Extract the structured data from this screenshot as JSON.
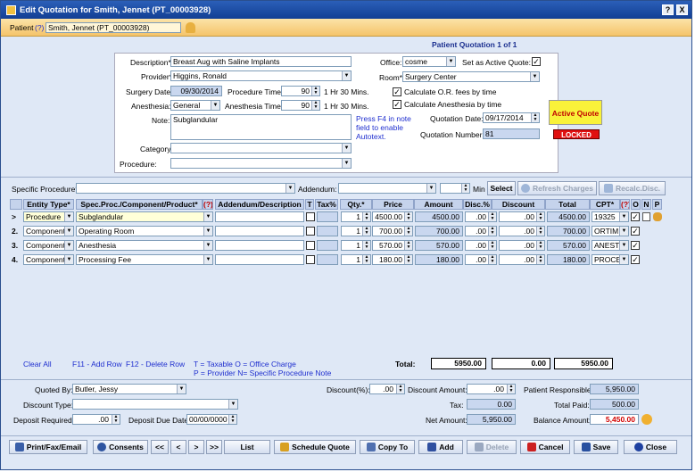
{
  "window": {
    "title": "Edit Quotation for Smith, Jennet  (PT_00003928)",
    "help": "?",
    "close": "X"
  },
  "patient": {
    "label": "Patient",
    "help": "(?)",
    "value": "Smith, Jennet  (PT_00003928)"
  },
  "header": {
    "quotation_title": "Patient Quotation 1 of 1",
    "description_label": "Description*",
    "description": "Breast Aug with Saline Implants",
    "provider_label": "Provider*",
    "provider": "Higgins, Ronald",
    "surgery_date_label": "Surgery Date:",
    "surgery_date": "09/30/2014",
    "procedure_time_label": "Procedure Time*",
    "procedure_time": "90",
    "procedure_time_text": "1 Hr 30 Mins.",
    "anesthesia_label": "Anesthesia:",
    "anesthesia": "General",
    "anesthesia_time_label": "Anesthesia Time:",
    "anesthesia_time": "90",
    "anesthesia_time_text": "1 Hr 30 Mins.",
    "note_label": "Note:",
    "note": "Subglandular",
    "note_hint": "Press F4 in note field to enable Autotext.",
    "category_label": "Category:",
    "category": "",
    "procedure_label": "Procedure:",
    "procedure": "",
    "office_label": "Office:",
    "office": "cosme",
    "active_quote_label": "Set as Active Quote:",
    "room_label": "Room*",
    "room": "Surgery Center",
    "calc_or_label": "Calculate O.R. fees by time",
    "calc_anesthesia_label": "Calculate Anesthesia by time",
    "quotation_date_label": "Quotation Date:",
    "quotation_date": "09/17/2014",
    "quotation_number_label": "Quotation Number:",
    "quotation_number": "81",
    "active_badge": "Active Quote",
    "locked_badge": "LOCKED"
  },
  "spec": {
    "specific_procedure_label": "Specific Procedure*",
    "addendum_label": "Addendum:",
    "min_label": "Min",
    "select_btn": "Select",
    "refresh_btn": "Refresh Charges",
    "recalc_btn": "Recalc.Disc."
  },
  "grid": {
    "columns": [
      "Entity Type*",
      "Spec.Proc./Component/Product*",
      "(?)",
      "Addendum/Description",
      "T",
      "Tax%",
      "Qty.*",
      "Price",
      "Amount",
      "Disc.%",
      "Discount",
      "Total",
      "CPT*",
      "(?)",
      "O",
      "N",
      "P"
    ],
    "rows": [
      {
        "marker": ">",
        "entity": "Procedure",
        "spec": "Subglandular",
        "qty": "1",
        "price": "4500.00",
        "amount": "4500.00",
        "disc_pct": ".00",
        "discount": ".00",
        "total": "4500.00",
        "cpt": "19325"
      },
      {
        "marker": "2.",
        "entity": "Component",
        "spec": "Operating Room",
        "qty": "1",
        "price": "700.00",
        "amount": "700.00",
        "disc_pct": ".00",
        "discount": ".00",
        "total": "700.00",
        "cpt": "ORTIM"
      },
      {
        "marker": "3.",
        "entity": "Component",
        "spec": "Anesthesia",
        "qty": "1",
        "price": "570.00",
        "amount": "570.00",
        "disc_pct": ".00",
        "discount": ".00",
        "total": "570.00",
        "cpt": "ANEST"
      },
      {
        "marker": "4.",
        "entity": "Component",
        "spec": "Processing Fee",
        "qty": "1",
        "price": "180.00",
        "amount": "180.00",
        "disc_pct": ".00",
        "discount": ".00",
        "total": "180.00",
        "cpt": "PROCE"
      }
    ]
  },
  "hints": {
    "clear_all": "Clear All",
    "add_row": "F11 - Add Row",
    "delete_row": "F12 - Delete Row",
    "legend1": "T = Taxable   O = Office Charge",
    "legend2": "P = Provider   N= Specific Procedure Note"
  },
  "totals": {
    "label": "Total:",
    "amount": "5950.00",
    "discount": "0.00",
    "total": "5950.00"
  },
  "footer": {
    "quoted_by_label": "Quoted By:",
    "quoted_by": "Butler, Jessy",
    "discount_type_label": "Discount Type:",
    "discount_type": "",
    "deposit_required_label": "Deposit Required:",
    "deposit_required": ".00",
    "deposit_due_label": "Deposit Due Date:",
    "deposit_due": "00/00/0000",
    "discount_pct_label": "Discount(%):",
    "discount_pct": ".00",
    "discount_amount_label": "Discount Amount:",
    "discount_amount": ".00",
    "tax_label": "Tax:",
    "tax": "0.00",
    "net_amount_label": "Net Amount:",
    "net_amount": "5,950.00",
    "patient_resp_label": "Patient Responsible:",
    "patient_resp": "5,950.00",
    "total_paid_label": "Total Paid:",
    "total_paid": "500.00",
    "balance_label": "Balance Amount:",
    "balance": "5,450.00"
  },
  "buttons": {
    "print": "Print/Fax/Email",
    "consents": "Consents",
    "first": "<<",
    "prev": "<",
    "next": ">",
    "last": ">>",
    "list": "List",
    "schedule": "Schedule Quote",
    "copy": "Copy To",
    "add": "Add",
    "delete": "Delete",
    "cancel": "Cancel",
    "save": "Save",
    "close": "Close"
  }
}
